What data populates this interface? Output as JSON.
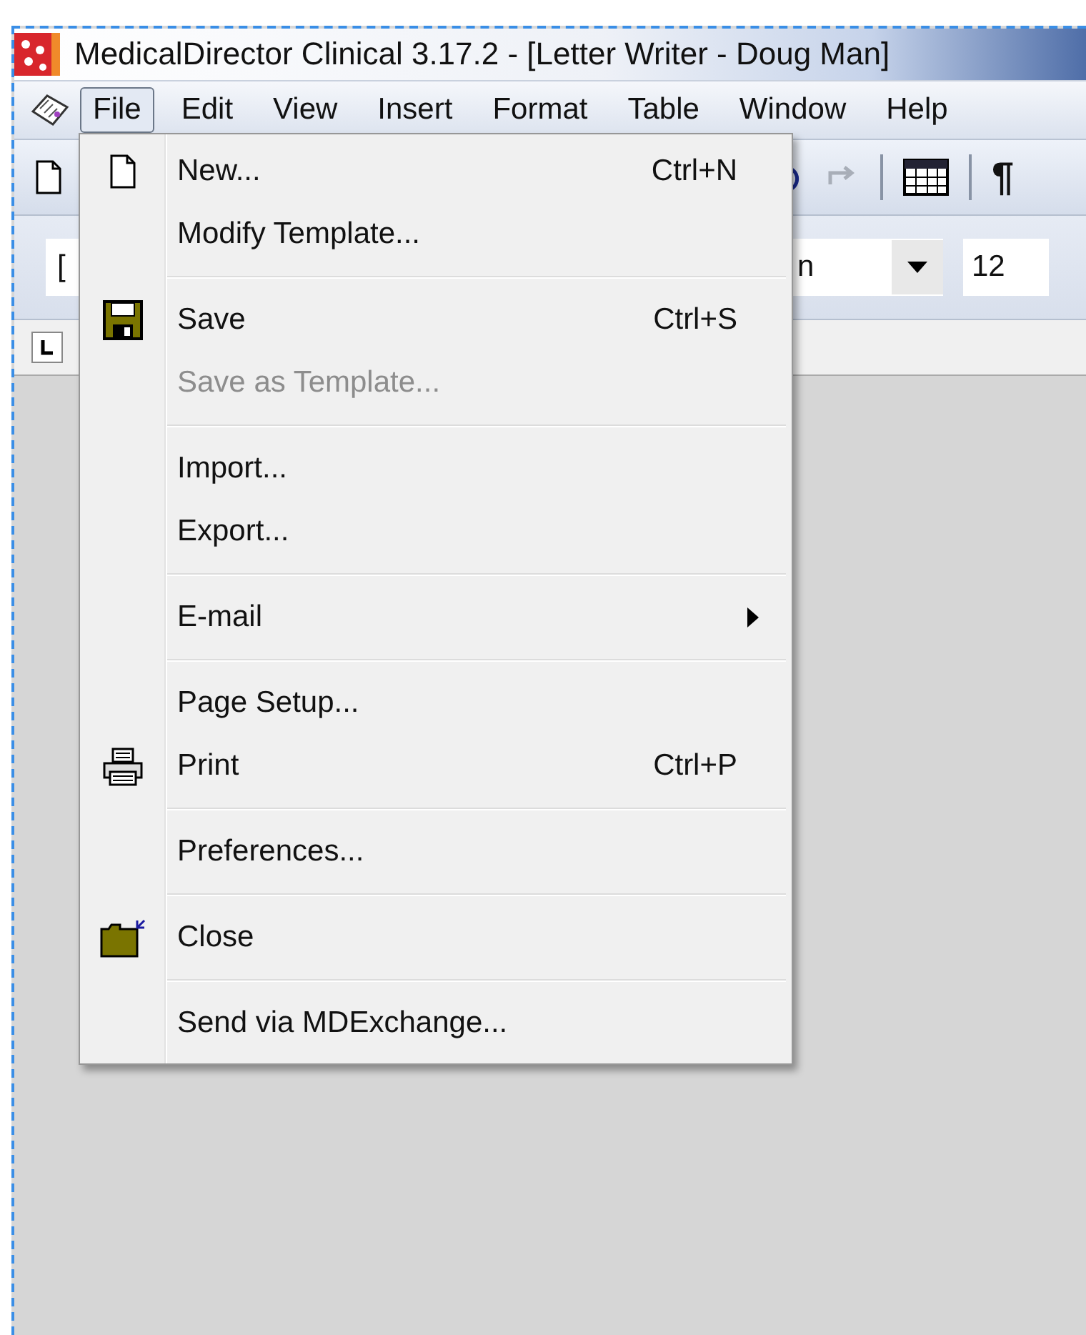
{
  "window": {
    "title": "MedicalDirector Clinical 3.17.2 - [Letter Writer - Doug Man]"
  },
  "menubar": {
    "items": [
      {
        "label": "File",
        "selected": true
      },
      {
        "label": "Edit",
        "selected": false
      },
      {
        "label": "View",
        "selected": false
      },
      {
        "label": "Insert",
        "selected": false
      },
      {
        "label": "Format",
        "selected": false
      },
      {
        "label": "Table",
        "selected": false
      },
      {
        "label": "Window",
        "selected": false
      },
      {
        "label": "Help",
        "selected": false
      }
    ]
  },
  "toolbar": {
    "pilcrow": "¶"
  },
  "format_bar": {
    "style_value": "[",
    "font_value": "n",
    "size_value": "12"
  },
  "file_menu": {
    "items": [
      {
        "kind": "page",
        "label": "New...",
        "shortcut": "Ctrl+N",
        "disabled": false
      },
      {
        "kind": "item",
        "label": "Modify Template...",
        "disabled": false
      },
      {
        "kind": "separator"
      },
      {
        "kind": "floppy",
        "label": "Save",
        "shortcut": "Ctrl+S",
        "disabled": false
      },
      {
        "kind": "item",
        "label": "Save as Template...",
        "disabled": true
      },
      {
        "kind": "separator"
      },
      {
        "kind": "item",
        "label": "Import...",
        "disabled": false
      },
      {
        "kind": "item",
        "label": "Export...",
        "disabled": false
      },
      {
        "kind": "separator"
      },
      {
        "kind": "item",
        "label": "E-mail",
        "submenu": true,
        "disabled": false
      },
      {
        "kind": "separator"
      },
      {
        "kind": "item",
        "label": "Page Setup...",
        "disabled": false
      },
      {
        "kind": "printer",
        "label": "Print",
        "shortcut": "Ctrl+P",
        "disabled": false
      },
      {
        "kind": "separator"
      },
      {
        "kind": "item",
        "label": "Preferences...",
        "disabled": false
      },
      {
        "kind": "separator"
      },
      {
        "kind": "folder",
        "label": "Close",
        "disabled": false
      },
      {
        "kind": "separator"
      },
      {
        "kind": "item",
        "label": "Send via MDExchange...",
        "disabled": false
      }
    ]
  }
}
